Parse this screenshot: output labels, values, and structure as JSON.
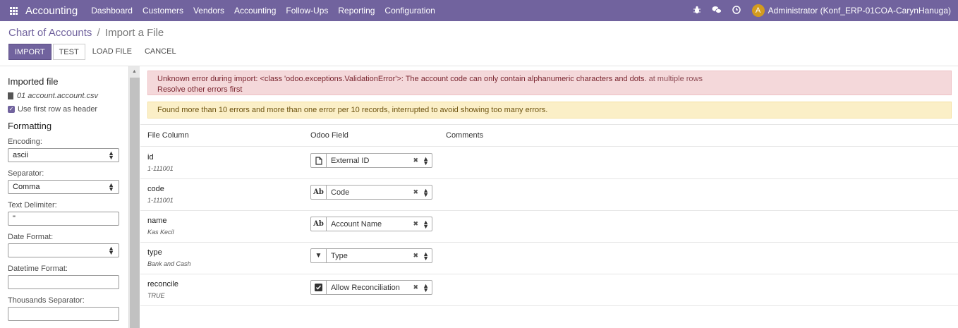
{
  "navbar": {
    "brand": "Accounting",
    "menu": [
      "Dashboard",
      "Customers",
      "Vendors",
      "Accounting",
      "Follow-Ups",
      "Reporting",
      "Configuration"
    ],
    "avatar_initial": "A",
    "user": "Administrator (Konf_ERP-01COA-CarynHanuga)",
    "color": "#71639e"
  },
  "breadcrumb": {
    "parent": "Chart of Accounts",
    "separator": "/",
    "current": "Import a File"
  },
  "buttons": {
    "import": "IMPORT",
    "test": "TEST",
    "load_file": "LOAD FILE",
    "cancel": "CANCEL"
  },
  "sidebar": {
    "imported_title": "Imported file",
    "file_name": "01 account.account.csv",
    "header_option": "Use first row as header",
    "formatting_title": "Formatting",
    "encoding_label": "Encoding:",
    "encoding_value": "ascii",
    "separator_label": "Separator:",
    "separator_value": "Comma",
    "delimiter_label": "Text Delimiter:",
    "delimiter_value": "\"",
    "date_label": "Date Format:",
    "date_value": "",
    "datetime_label": "Datetime Format:",
    "datetime_value": "",
    "thousands_label": "Thousands Separator:"
  },
  "alerts": {
    "error_main": "Unknown error during import: <class 'odoo.exceptions.ValidationError'>: The account code can only contain alphanumeric characters and dots.",
    "error_suffix": " at multiple rows",
    "error_sub": "Resolve other errors first",
    "warning": "Found more than 10 errors and more than one error per 10 records, interrupted to avoid showing too many errors."
  },
  "table": {
    "headers": [
      "File Column",
      "Odoo Field",
      "Comments"
    ],
    "rows": [
      {
        "name": "id",
        "sample": "1-111001",
        "field": "External ID",
        "icon": "file-icon"
      },
      {
        "name": "code",
        "sample": "1-111001",
        "field": "Code",
        "icon": "text-icon"
      },
      {
        "name": "name",
        "sample": "Kas Kecil",
        "field": "Account Name",
        "icon": "text-icon"
      },
      {
        "name": "type",
        "sample": "Bank and Cash",
        "field": "Type",
        "icon": "caret-down-icon"
      },
      {
        "name": "reconcile",
        "sample": "TRUE",
        "field": "Allow Reconciliation",
        "icon": "checkbox-icon"
      }
    ]
  },
  "glyphs": {
    "text_icon": "Ab",
    "check": "✓",
    "clear": "✖",
    "up": "▲",
    "down": "▼"
  }
}
